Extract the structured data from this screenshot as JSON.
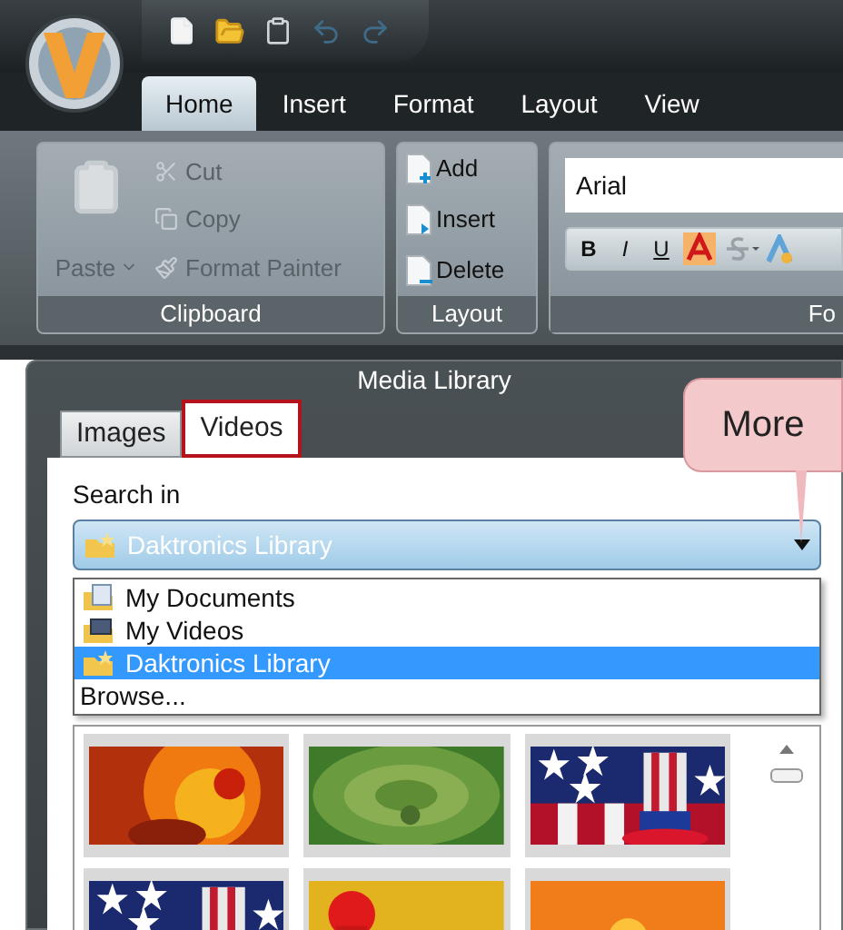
{
  "ribbon_tabs": [
    {
      "label": "Home",
      "selected": true
    },
    {
      "label": "Insert",
      "selected": false
    },
    {
      "label": "Format",
      "selected": false
    },
    {
      "label": "Layout",
      "selected": false
    },
    {
      "label": "View",
      "selected": false
    }
  ],
  "clipboard_group": {
    "label": "Clipboard",
    "paste": {
      "label": "Paste",
      "disabled": true
    },
    "items": [
      {
        "label": "Cut",
        "disabled": true
      },
      {
        "label": "Copy",
        "disabled": true
      },
      {
        "label": "Format Painter",
        "disabled": true
      }
    ]
  },
  "layout_group": {
    "label": "Layout",
    "items": [
      {
        "label": "Add",
        "kind": "add"
      },
      {
        "label": "Insert",
        "kind": "insert"
      },
      {
        "label": "Delete",
        "kind": "delete"
      }
    ]
  },
  "font_group": {
    "label": "Fo",
    "font_name": "Arial",
    "format_buttons": [
      "B",
      "I",
      "U"
    ]
  },
  "media_library": {
    "title": "Media Library",
    "tabs": [
      {
        "label": "Images",
        "selected": false,
        "highlighted": false
      },
      {
        "label": "Videos",
        "selected": true,
        "highlighted": true
      }
    ],
    "search_label": "Search in",
    "combo_value": "Daktronics Library",
    "options": [
      {
        "label": "My Documents",
        "kind": "documents",
        "selected": false
      },
      {
        "label": "My Videos",
        "kind": "videos",
        "selected": false
      },
      {
        "label": "Daktronics Library",
        "kind": "library",
        "selected": true
      },
      {
        "label": "Browse...",
        "kind": "browse",
        "selected": false
      }
    ]
  },
  "callout": {
    "text": "More"
  }
}
